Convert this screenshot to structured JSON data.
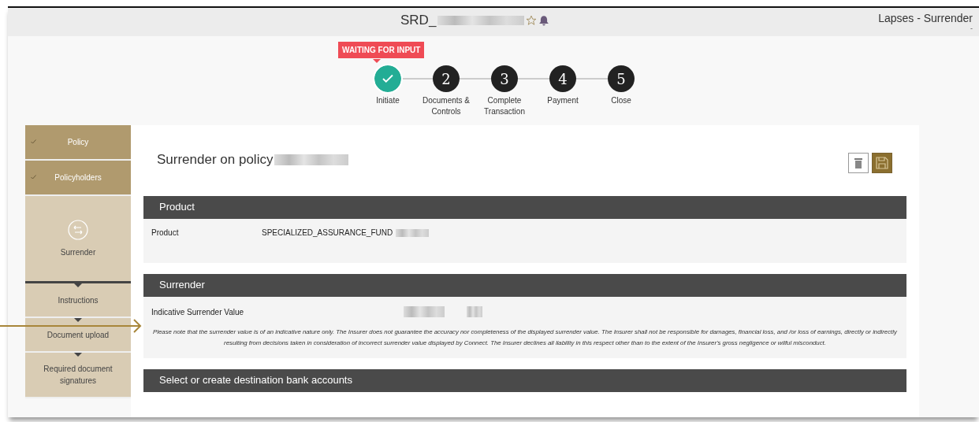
{
  "header": {
    "title": "SRD_",
    "starred": false,
    "breadcrumb": "Lapses - Surrender",
    "breadcrumb_sub": "-"
  },
  "stepper": {
    "badge": "WAITING FOR INPUT",
    "steps": [
      {
        "label": "Initiate",
        "done": true,
        "selected": true
      },
      {
        "number": "2",
        "label": "Documents & Controls",
        "done": false,
        "selected": false
      },
      {
        "number": "3",
        "label": "Complete Transaction",
        "done": false,
        "selected": false
      },
      {
        "number": "4",
        "label": "Payment",
        "done": false,
        "selected": false
      },
      {
        "number": "5",
        "label": "Close",
        "done": false,
        "selected": false
      }
    ]
  },
  "sidebar": {
    "items": [
      {
        "kind": "section",
        "label": "Policy",
        "done": true
      },
      {
        "kind": "section",
        "label": "Policyholders",
        "done": true
      },
      {
        "kind": "current",
        "label": "Surrender",
        "done": false
      },
      {
        "kind": "sub",
        "label": "Instructions",
        "done": false
      },
      {
        "kind": "sub",
        "label": "Document upload",
        "done": false
      },
      {
        "kind": "sub",
        "label": "Required document signatures",
        "done": false
      }
    ]
  },
  "main": {
    "title": "Surrender on policy",
    "sections": [
      {
        "title": "Product",
        "rows": [
          {
            "label": "Product",
            "value": "SPECIALIZED_ASSURANCE_FUND"
          }
        ]
      },
      {
        "title": "Surrender",
        "rows": [
          {
            "label": "Indicative Surrender Value"
          }
        ],
        "note": "Please note that the surrender value is of an indicative nature only. The Insurer does not guarantee the accuracy nor completeness of the displayed surrender value. The Insurer shall not be responsible for damages, financial loss, and /or loss of earnings, directly or indirectly resulting from decisions taken in consideration of incorrect surrender value displayed by Connect. The Insurer declines all liability in this respect other than to the extent of the Insurer's gross negligence or wilful misconduct."
      },
      {
        "title": "Select or create destination bank accounts"
      }
    ]
  }
}
